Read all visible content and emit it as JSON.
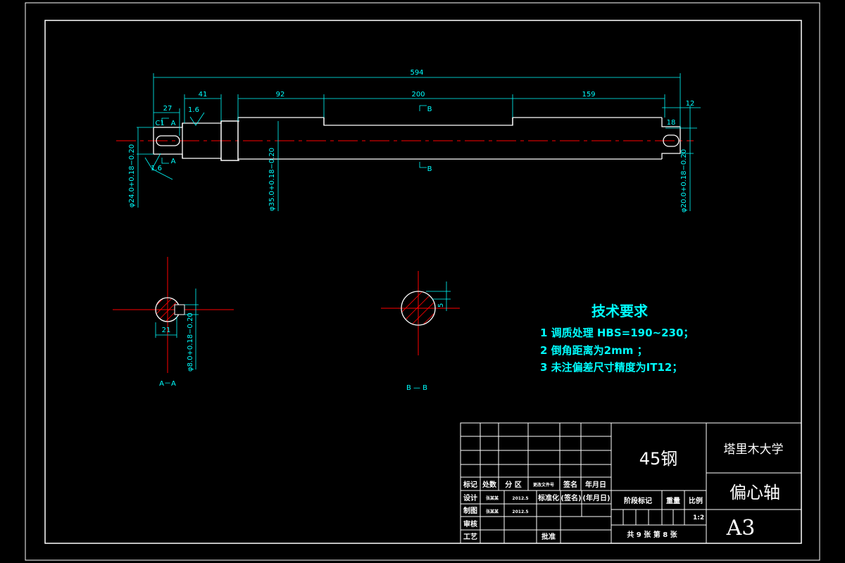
{
  "colors": {
    "background": "#000000",
    "outline": "#ffffff",
    "dimension": "#00ffff",
    "centerline": "#ff0000",
    "hatch": "#ff0000"
  },
  "main_view": {
    "dim_total": "594",
    "dim_41": "41",
    "dim_92": "92",
    "dim_200": "200",
    "dim_159": "159",
    "dim_27": "27",
    "dim_12": "12",
    "dim_18": "18",
    "roughness_1": "1.6",
    "roughness_2": "1.6",
    "chamfer": "C1",
    "section_a_top": "A",
    "section_a_bottom": "A",
    "section_b_top": "B",
    "section_b_bottom": "B",
    "dia_left": "φ24.0+0.18−0.20",
    "dia_mid": "φ35.0+0.18−0.20",
    "dia_right": "φ20.0+0.18−0.20"
  },
  "section_aa": {
    "width_dim": "21",
    "dia_dim": "φ8.0+0.18−0.20",
    "label": "A－A"
  },
  "section_bb": {
    "depth_dim": "5",
    "label": "B — B"
  },
  "tech_requirements": {
    "title": "技术要求",
    "items": [
      "1  调质处理 HBS=190~230；",
      "2  倒角距离为2mm  ；",
      "3  未注偏差尺寸精度为IT12；"
    ]
  },
  "title_block": {
    "material": "45钢",
    "school": "塔里木大学",
    "part_name": "偏心轴",
    "paper_size": "A3",
    "row_headers": [
      "标记",
      "处数",
      "分 区",
      "更改文件号",
      "签名",
      "年月日"
    ],
    "design_label": "设计",
    "design_name": "张某某",
    "design_date": "2012.5",
    "std_label": "标准化",
    "sign_label": "(签名)",
    "date_label": "(年月日)",
    "draw_label": "制图",
    "draw_name": "张某某",
    "draw_date": "2012.5",
    "check_label": "审核",
    "craft_label": "工艺",
    "approve_label": "批准",
    "stage_label": "阶段标记",
    "weight_label": "重量",
    "scale_label": "比例",
    "scale_value": "1:2",
    "sheets": "共 9 张  第 8 张"
  }
}
